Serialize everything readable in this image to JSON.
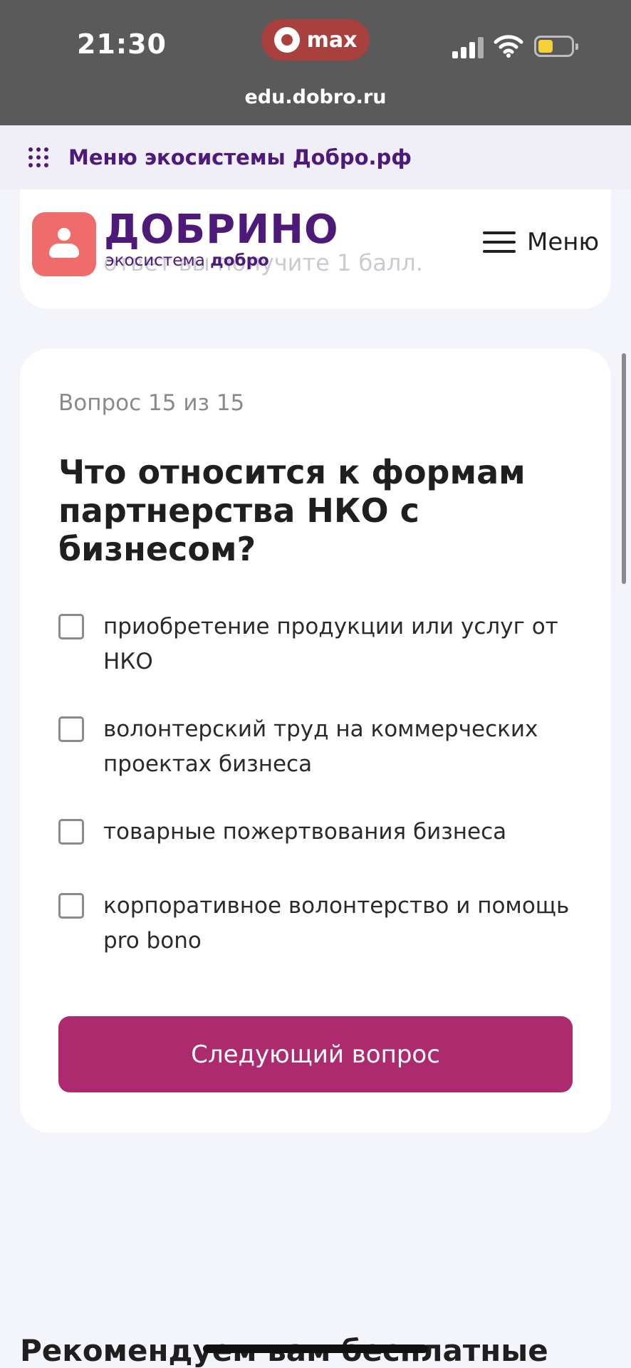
{
  "status_bar": {
    "time": "21:30",
    "app_pill_label": "max",
    "url": "edu.dobro.ru",
    "battery_color": "#f5d13b"
  },
  "eco_menu": {
    "label": "Меню экосистемы Добро.рф",
    "icon": "grid-dots-icon"
  },
  "header": {
    "logo_title": "ДОБРИНО",
    "logo_subtitle_prefix": "экосистема ",
    "logo_subtitle_bold": "добро",
    "menu_label": "Меню",
    "previous_card_text": "ответ вы получите 1 балл."
  },
  "quiz": {
    "counter": "Вопрос 15 из 15",
    "question": "Что относится к формам партнерства НКО с бизнесом?",
    "options": [
      {
        "label": "приобретение продукции или услуг от НКО",
        "checked": false
      },
      {
        "label": "волонтерский труд на коммерческих проектах бизнеса",
        "checked": false
      },
      {
        "label": "товарные пожертвования бизнеса",
        "checked": false
      },
      {
        "label": "корпоративное волонтерство и помощь pro bono",
        "checked": false
      }
    ],
    "next_button_label": "Следующий вопрос",
    "accent_color": "#ad2a6f"
  },
  "recommend": {
    "title": "Рекомендуем вам бесплатные"
  },
  "colors": {
    "brand_purple": "#4d1a7a",
    "logo_coral": "#ee6d6a"
  }
}
